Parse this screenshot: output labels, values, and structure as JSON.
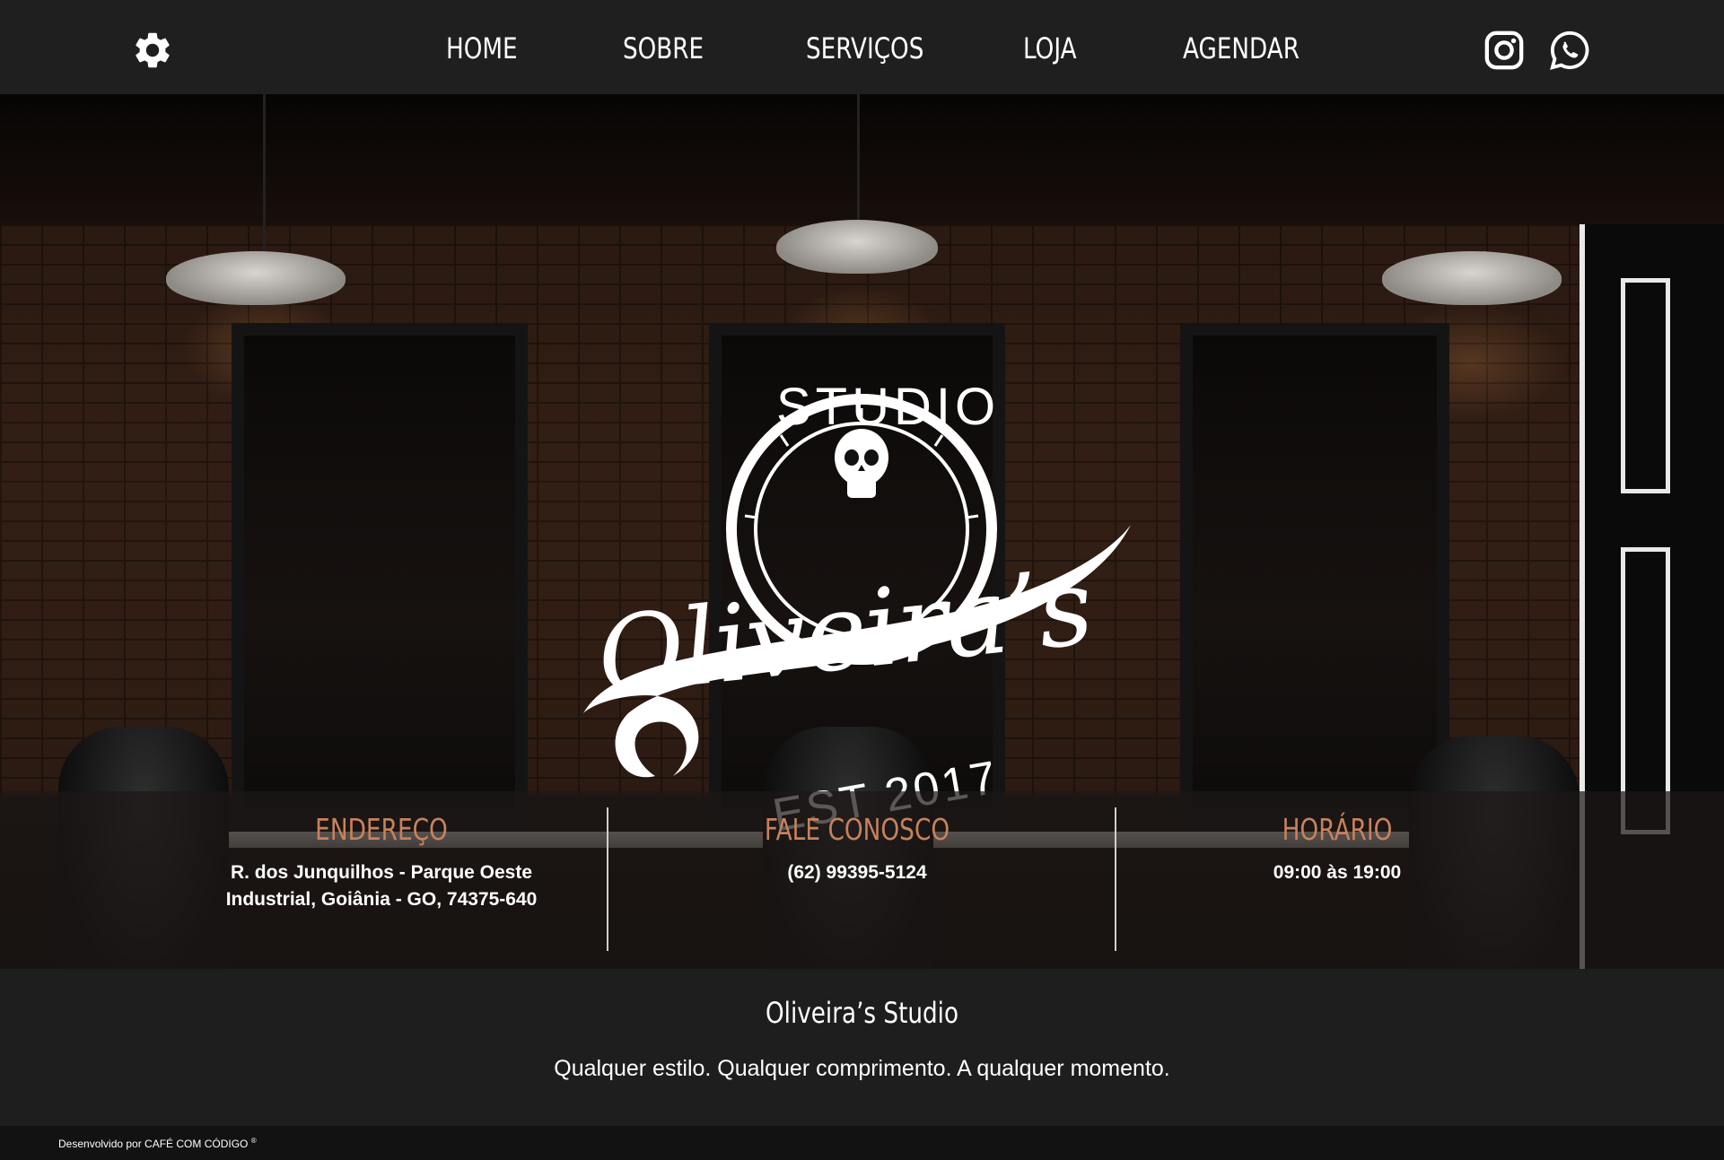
{
  "nav": {
    "items": [
      {
        "label": "HOME"
      },
      {
        "label": "SOBRE"
      },
      {
        "label": "SERVIÇOS"
      },
      {
        "label": "LOJA"
      },
      {
        "label": "AGENDAR"
      }
    ],
    "icons": {
      "settings": "gear-icon",
      "instagram": "instagram-icon",
      "whatsapp": "whatsapp-icon"
    }
  },
  "logo": {
    "studio": "STUDIO",
    "name": "Oliveira’s",
    "est": "EST 2017"
  },
  "info": {
    "address": {
      "title": "ENDEREÇO",
      "line1": "R. dos Junquilhos - Parque Oeste",
      "line2": "Industrial, Goiânia - GO, 74375-640"
    },
    "contact": {
      "title": "FALE CONOSCO",
      "phone": "(62) 99395-5124"
    },
    "hours": {
      "title": "HORÁRIO",
      "value": "09:00 às 19:00"
    }
  },
  "footer": {
    "title": "Oliveira’s Studio",
    "tagline": "Qualquer estilo. Qualquer comprimento. A qualquer momento.",
    "credits": "Desenvolvido por CAFÉ COM CÓDIGO",
    "credits_mark": "®"
  },
  "colors": {
    "accent": "#c8825c",
    "nav_bg": "#1f1f1f",
    "footer_bg": "#1e1e1e"
  }
}
